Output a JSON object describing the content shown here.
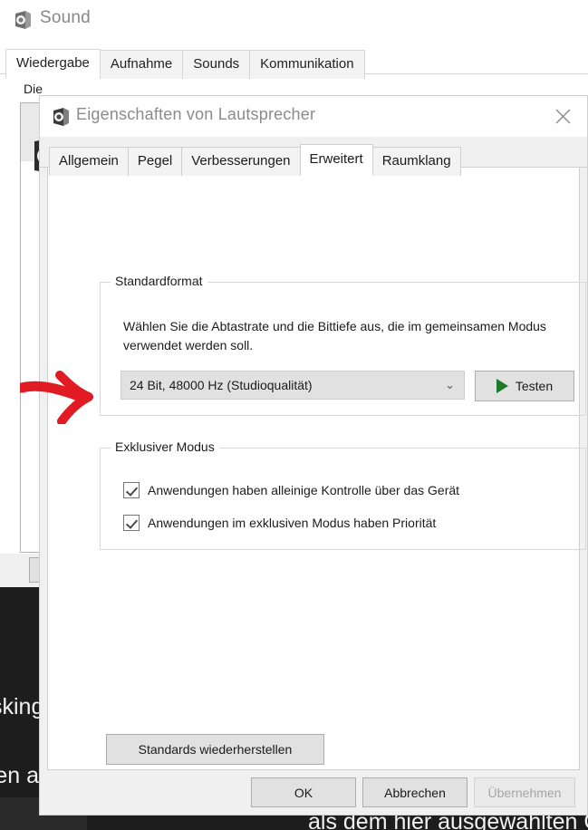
{
  "sound_window": {
    "title": "Sound",
    "icon": "speaker-icon",
    "tabs": [
      {
        "label": "Wiedergabe",
        "active": true
      },
      {
        "label": "Aufnahme",
        "active": false
      },
      {
        "label": "Sounds",
        "active": false
      },
      {
        "label": "Kommunikation",
        "active": false
      }
    ],
    "hint_text": "Die"
  },
  "backdrop": {
    "text_fragment_1": "sking",
    "text_fragment_2": "ren a",
    "text_fragment_3": "als dem hier ausgewählten G",
    "color": "#1d1d1d"
  },
  "dialog": {
    "title": "Eigenschaften von Lautsprecher",
    "icon": "speaker-icon",
    "close_label": "✕",
    "tabs": [
      {
        "label": "Allgemein",
        "active": false
      },
      {
        "label": "Pegel",
        "active": false
      },
      {
        "label": "Verbesserungen",
        "active": false
      },
      {
        "label": "Erweitert",
        "active": true
      },
      {
        "label": "Raumklang",
        "active": false
      }
    ],
    "standard_format": {
      "group_title": "Standardformat",
      "description": "Wählen Sie die Abtastrate und die Bittiefe aus, die im gemeinsamen Modus verwendet werden soll.",
      "combo_value": "24 Bit, 48000 Hz (Studioqualität)",
      "combo_chevron": "⌄",
      "test_button": "Testen"
    },
    "exclusive_mode": {
      "group_title": "Exklusiver Modus",
      "checkbox_1": {
        "label": "Anwendungen haben alleinige Kontrolle über das Gerät",
        "checked": true
      },
      "checkbox_2": {
        "label": "Anwendungen im exklusiven Modus haben Priorität",
        "checked": true
      }
    },
    "restore_button": "Standards wiederherstellen",
    "footer": {
      "ok": "OK",
      "cancel": "Abbrechen",
      "apply": "Übernehmen",
      "apply_disabled": true
    }
  },
  "annotation": {
    "type": "arrow",
    "color": "#e01b24",
    "points_to": "checkbox-exclusive-control"
  }
}
